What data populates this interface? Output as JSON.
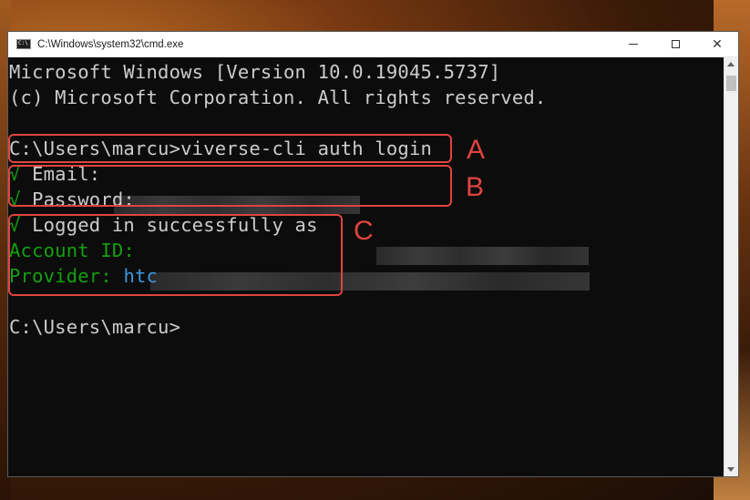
{
  "window": {
    "title": "C:\\Windows\\system32\\cmd.exe",
    "icons": {
      "app": "cmd-icon",
      "minimize": "minimize-icon",
      "maximize": "maximize-icon",
      "close": "close-icon"
    },
    "close_glyph": "✕"
  },
  "console": {
    "header_line1": "Microsoft Windows [Version 10.0.19045.5737]",
    "header_line2": "(c) Microsoft Corporation. All rights reserved.",
    "command": "C:\\Users\\marcu>viverse-cli auth login",
    "check_mark": "√",
    "email_label": " Email:",
    "password_label": " Password:",
    "logged_in": " Logged in successfully as",
    "account_id_label": "Account ID:",
    "provider_label": "Provider:",
    "provider_value": "htc",
    "prompt": "C:\\Users\\marcu>"
  },
  "annotations": {
    "a": "A",
    "b": "B",
    "c": "C"
  },
  "colors": {
    "annotation": "#e0443f",
    "console_bg": "#0c0c0c",
    "console_text": "#cccccc",
    "success_green": "#13a10e",
    "provider_cyan": "#3a96dd"
  }
}
